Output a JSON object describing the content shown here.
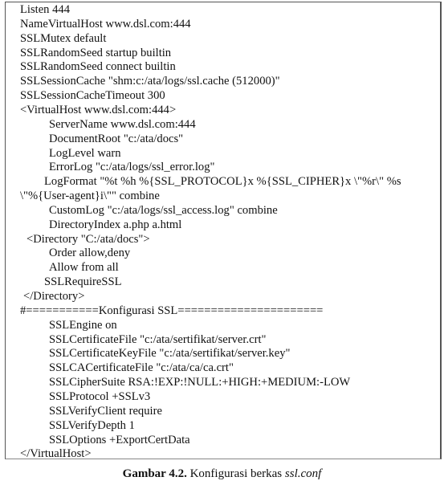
{
  "config_lines": [
    {
      "text": "Listen 444",
      "indent": 0
    },
    {
      "text": "NameVirtualHost www.dsl.com:444",
      "indent": 0
    },
    {
      "text": "SSLMutex default",
      "indent": 0
    },
    {
      "text": "SSLRandomSeed startup builtin",
      "indent": 0
    },
    {
      "text": "SSLRandomSeed connect builtin",
      "indent": 0
    },
    {
      "text": "SSLSessionCache \"shm:c:/ata/logs/ssl.cache (512000)\"",
      "indent": 0
    },
    {
      "text": "SSLSessionCacheTimeout 300",
      "indent": 0
    },
    {
      "text": "<VirtualHost www.dsl.com:444>",
      "indent": 0
    },
    {
      "text": "ServerName www.dsl.com:444",
      "indent": 2
    },
    {
      "text": "DocumentRoot \"c:/ata/docs\"",
      "indent": 2
    },
    {
      "text": "LogLevel warn",
      "indent": 2
    },
    {
      "text": "ErrorLog \"c:/ata/logs/ssl_error.log\"",
      "indent": 2
    },
    {
      "text": "LogFormat \"%t %h %{SSL_PROTOCOL}x %{SSL_CIPHER}x \\\"%r\\\" %s",
      "indent": 1.5
    },
    {
      "text": "\\\"%{User-agent}i\\\"\" combine",
      "indent": 0
    },
    {
      "text": "CustomLog \"c:/ata/logs/ssl_access.log\" combine",
      "indent": 2
    },
    {
      "text": "DirectoryIndex a.php a.html",
      "indent": 2
    },
    {
      "text": "<Directory \"C:/ata/docs\">",
      "indent": 0.5
    },
    {
      "text": "Order allow,deny",
      "indent": 2
    },
    {
      "text": "Allow from all",
      "indent": 2
    },
    {
      "text": "SSLRequireSSL",
      "indent": 1.5
    },
    {
      "text": "</Directory>",
      "indent": 0.25
    },
    {
      "text": "#===========Konfigurasi SSL======================",
      "indent": 0
    },
    {
      "text": "SSLEngine on",
      "indent": 2
    },
    {
      "text": "SSLCertificateFile \"c:/ata/sertifikat/server.crt\"",
      "indent": 2
    },
    {
      "text": "SSLCertificateKeyFile \"c:/ata/sertifikat/server.key\"",
      "indent": 2
    },
    {
      "text": "SSLCACertificateFile \"c:/ata/ca/ca.crt\"",
      "indent": 2
    },
    {
      "text": "SSLCipherSuite RSA:!EXP:!NULL:+HIGH:+MEDIUM:-LOW",
      "indent": 2
    },
    {
      "text": "SSLProtocol +SSLv3",
      "indent": 2
    },
    {
      "text": "SSLVerifyClient require",
      "indent": 2
    },
    {
      "text": "SSLVerifyDepth 1",
      "indent": 2
    },
    {
      "text": "SSLOptions +ExportCertData",
      "indent": 2
    },
    {
      "text": "</VirtualHost>",
      "indent": 0
    }
  ],
  "caption": {
    "label": "Gambar 4.2.",
    "text": " Konfigurasi berkas ",
    "filename": "ssl.conf"
  }
}
